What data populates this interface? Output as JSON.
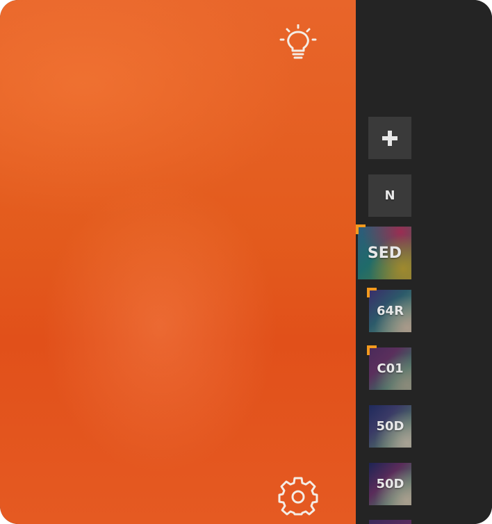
{
  "icons": {
    "top": "lightbulb-icon",
    "bottom": "gear-icon",
    "add": "plus-icon"
  },
  "colors": {
    "canvas": "#e35b1d",
    "sidebar": "#242424",
    "tile": "#3a3a3a",
    "marker": "#f39a1e"
  },
  "sidebar": {
    "items": [
      {
        "label": "N"
      },
      {
        "label": "SED",
        "selected": true
      },
      {
        "label": "64R",
        "marked": true
      },
      {
        "label": "C01",
        "marked": true
      },
      {
        "label": "50D"
      },
      {
        "label": "50D"
      }
    ]
  }
}
